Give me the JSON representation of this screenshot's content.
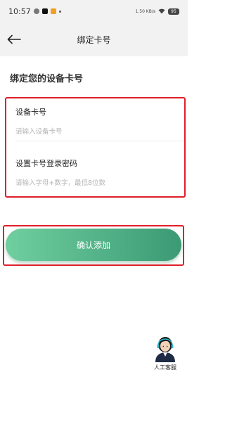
{
  "status_bar": {
    "time": "10:57",
    "network": "1.50 KB/s",
    "battery": "95"
  },
  "nav": {
    "title": "绑定卡号"
  },
  "form": {
    "section_title": "绑定您的设备卡号",
    "card_number_label": "设备卡号",
    "card_number_placeholder": "请输入设备卡号",
    "password_label": "设置卡号登录密码",
    "password_placeholder": "请输入字母+数字，最低8位数"
  },
  "confirm_button": {
    "label": "确认添加"
  },
  "service": {
    "label": "人工客服"
  },
  "colors": {
    "accent_start": "#6fcf9f",
    "accent_end": "#3b9a74",
    "highlight_border": "#e01f2a"
  },
  "icons": {
    "back": "arrow-left-icon",
    "service": "customer-service-avatar-icon"
  }
}
